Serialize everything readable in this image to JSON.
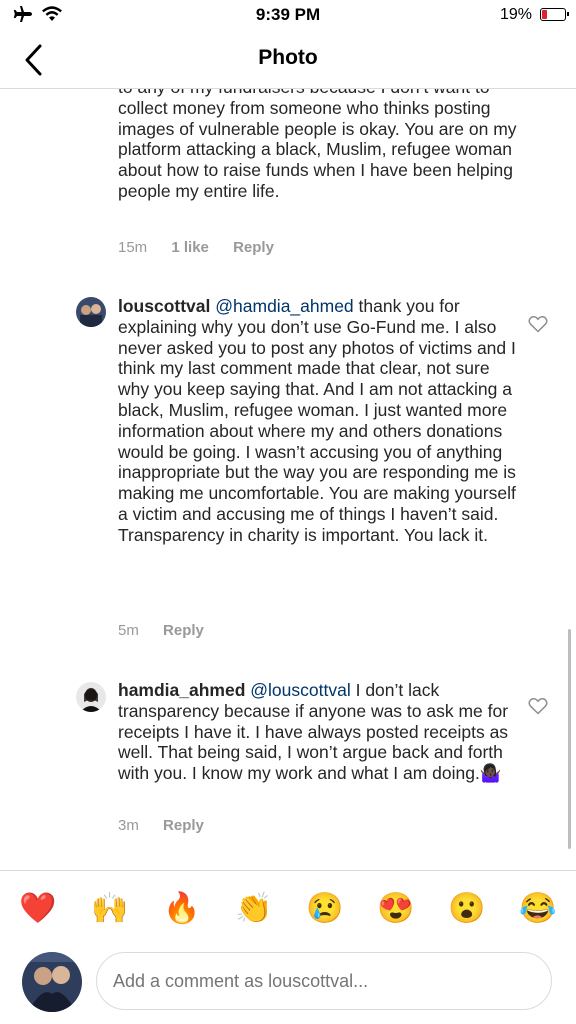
{
  "status_bar": {
    "time": "9:39 PM",
    "battery": "19%",
    "battery_color": "#e1202c"
  },
  "nav": {
    "title": "Photo"
  },
  "comments": [
    {
      "text": "to any of my fundraisers because I don’t want to collect money from someone who thinks posting images of vulnerable people is okay. You are on my platform attacking a black, Muslim, refugee woman about how to raise funds when I have been helping people my entire life.",
      "time": "15m",
      "likes": "1 like",
      "reply": "Reply"
    },
    {
      "user": "louscottval",
      "mention": "@hamdia_ahmed",
      "text": " thank you for explaining why you don’t use Go-Fund me. I also never asked you to post any photos of victims and I think my last comment made that clear, not sure why you keep saying that. And I am not attacking a black, Muslim, refugee woman. I just wanted more information about where my and others donations would be going. I wasn’t accusing you of anything inappropriate but the way you are responding me is making me uncomfortable. You are making yourself a victim and accusing me of things I haven’t said. Transparency in charity is important. You lack it.",
      "time": "5m",
      "reply": "Reply"
    },
    {
      "user": "hamdia_ahmed",
      "mention": "@louscottval",
      "text": "  I don’t lack transparency because if anyone was to ask me for receipts I have it. I have always posted receipts as well. That being said, I won’t argue back and forth with you. I know my work and what I am doing.🤷🏿‍♀️",
      "time": "3m",
      "reply": "Reply"
    }
  ],
  "emoji_bar": [
    "❤️",
    "🙌",
    "🔥",
    "👏",
    "😢",
    "😍",
    "😮",
    "😂"
  ],
  "comment_input": {
    "placeholder": "Add a comment as louscottval..."
  },
  "icons": [
    "airplane-icon",
    "wifi-icon",
    "back-chevron-icon",
    "heart-outline-icon"
  ]
}
